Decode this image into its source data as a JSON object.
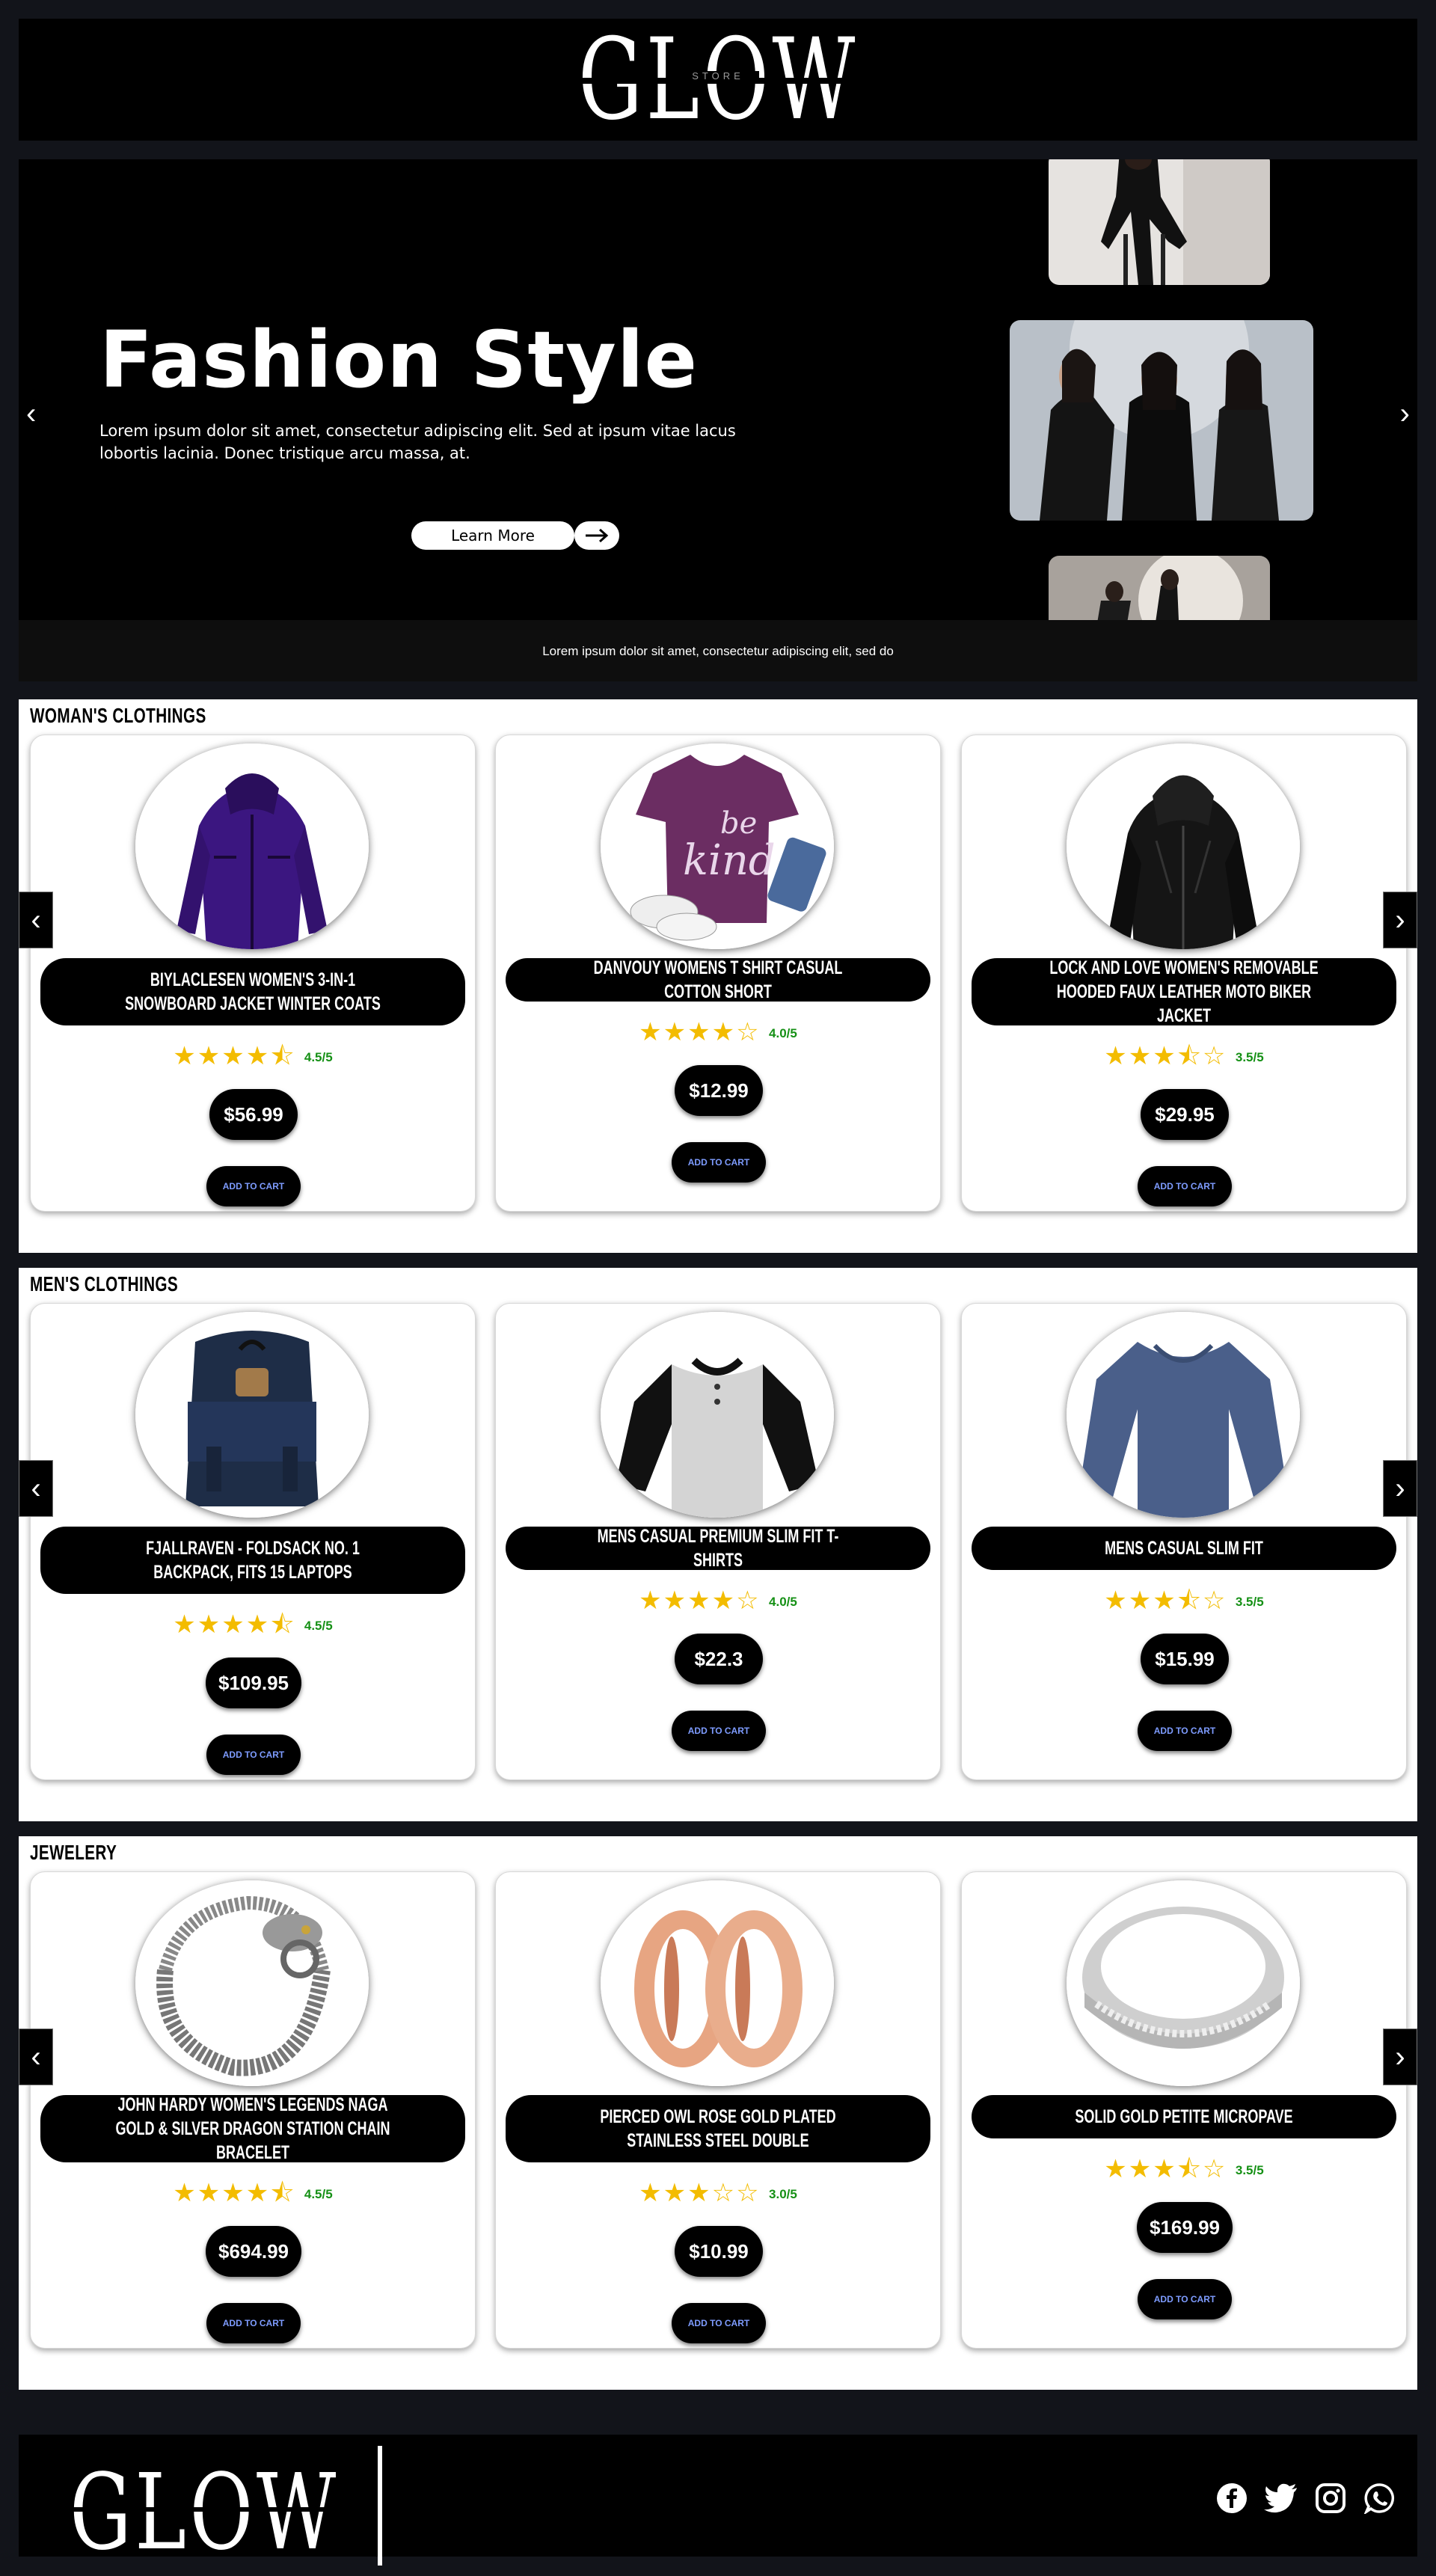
{
  "header": {
    "logo_text": "GLOW",
    "logo_sub": "STORE"
  },
  "hero": {
    "title": "Fashion Style",
    "text": "Lorem ipsum dolor sit amet, consectetur adipiscing elit. Sed at ipsum vitae lacus lobortis lacinia. Donec tristique arcu massa, at.",
    "button_label": "Learn More",
    "button_icon": "arrow-right-icon",
    "caption": "Lorem ipsum dolor sit amet, consectetur adipiscing elit, sed do",
    "prev": "‹",
    "next": "›"
  },
  "sections": [
    {
      "title": "WOMAN'S CLOTHINGS",
      "products": [
        {
          "name": "BIYLACLESEN WOMEN'S 3-IN-1 SNOWBOARD JACKET WINTER COATS",
          "rating": "4.5/5",
          "price": "$56.99",
          "cart": "ADD TO CART"
        },
        {
          "name": "DANVOUY WOMENS T SHIRT CASUAL COTTON SHORT",
          "rating": "4.0/5",
          "price": "$12.99",
          "cart": "ADD TO CART"
        },
        {
          "name": "LOCK AND LOVE WOMEN'S REMOVABLE HOODED FAUX LEATHER MOTO BIKER JACKET",
          "rating": "3.5/5",
          "price": "$29.95",
          "cart": "ADD TO CART"
        }
      ]
    },
    {
      "title": "MEN'S CLOTHINGS",
      "products": [
        {
          "name": "FJALLRAVEN - FOLDSACK NO. 1 BACKPACK, FITS 15 LAPTOPS",
          "rating": "4.5/5",
          "price": "$109.95",
          "cart": "ADD TO CART"
        },
        {
          "name": "MENS CASUAL PREMIUM SLIM FIT T-SHIRTS",
          "rating": "4.0/5",
          "price": "$22.3",
          "cart": "ADD TO CART"
        },
        {
          "name": "MENS CASUAL SLIM FIT",
          "rating": "3.5/5",
          "price": "$15.99",
          "cart": "ADD TO CART"
        }
      ]
    },
    {
      "title": "JEWELERY",
      "products": [
        {
          "name": "JOHN HARDY WOMEN'S LEGENDS NAGA GOLD & SILVER DRAGON STATION CHAIN BRACELET",
          "rating": "4.5/5",
          "price": "$694.99",
          "cart": "ADD TO CART"
        },
        {
          "name": "PIERCED OWL ROSE GOLD PLATED STAINLESS STEEL DOUBLE",
          "rating": "3.0/5",
          "price": "$10.99",
          "cart": "ADD TO CART"
        },
        {
          "name": "SOLID GOLD PETITE MICROPAVE",
          "rating": "3.5/5",
          "price": "$169.99",
          "cart": "ADD TO CART"
        }
      ]
    }
  ],
  "nav": {
    "prev": "‹",
    "next": "›"
  },
  "footer": {
    "logo_text": "GLOW",
    "socials": [
      "facebook-icon",
      "twitter-icon",
      "instagram-icon",
      "whatsapp-icon"
    ]
  },
  "colors": {
    "page_bg": "#12141a",
    "accent_star": "#f3bc00",
    "rating_text": "#159015",
    "cart_text": "#7e9cff"
  }
}
